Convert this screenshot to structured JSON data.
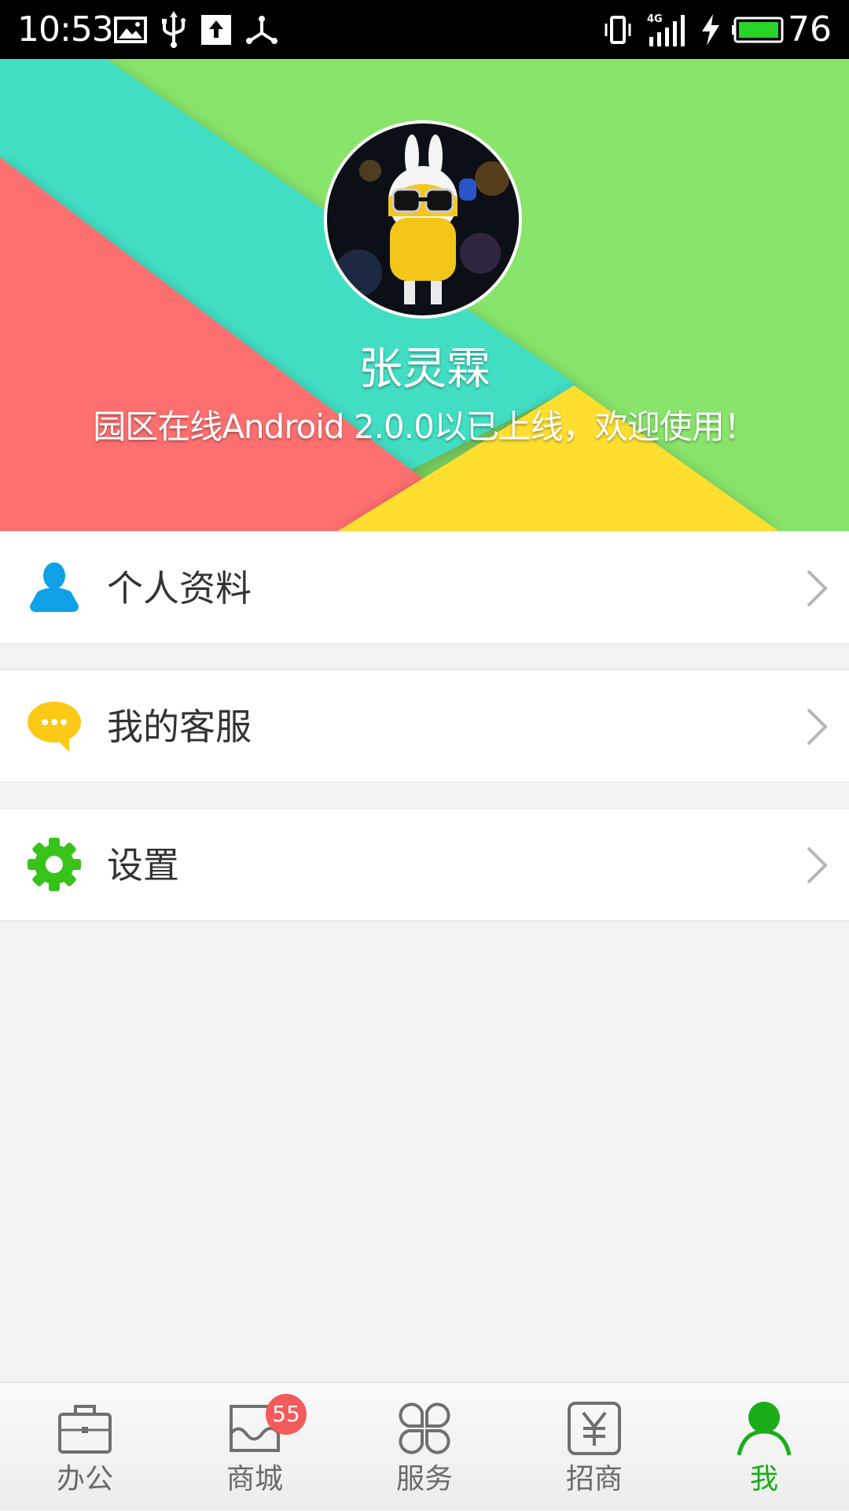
{
  "status_bar": {
    "time": "10:53",
    "battery_level": "76",
    "network": "4G",
    "icons": [
      "image-icon",
      "usb-icon",
      "upload-icon",
      "share-network-icon",
      "vibrate-icon",
      "signal-4g-icon",
      "charging-icon",
      "battery-icon"
    ]
  },
  "profile": {
    "name": "张灵霖",
    "notice": "园区在线Android 2.0.0以已上线，欢迎使用！"
  },
  "menu": [
    {
      "label": "个人资料",
      "icon": "person-icon"
    },
    {
      "label": "我的客服",
      "icon": "chat-bubble-icon"
    },
    {
      "label": "设置",
      "icon": "gear-icon"
    }
  ],
  "nav": [
    {
      "label": "办公",
      "icon": "briefcase-icon"
    },
    {
      "label": "商城",
      "icon": "store-icon",
      "badge": "55"
    },
    {
      "label": "服务",
      "icon": "grid-icon"
    },
    {
      "label": "招商",
      "icon": "yen-icon"
    },
    {
      "label": "我",
      "icon": "user-icon",
      "active": true
    }
  ],
  "colors": {
    "accent_green": "#1aad19",
    "banner_green": "#88e46a",
    "banner_teal": "#43dec4",
    "banner_red": "#fe6f6f",
    "banner_yellow": "#fede2f",
    "badge_red": "#f25b5b",
    "profile_icon_blue": "#10a0e8",
    "service_icon_yellow": "#fcc917",
    "settings_icon_green": "#37c31a"
  }
}
